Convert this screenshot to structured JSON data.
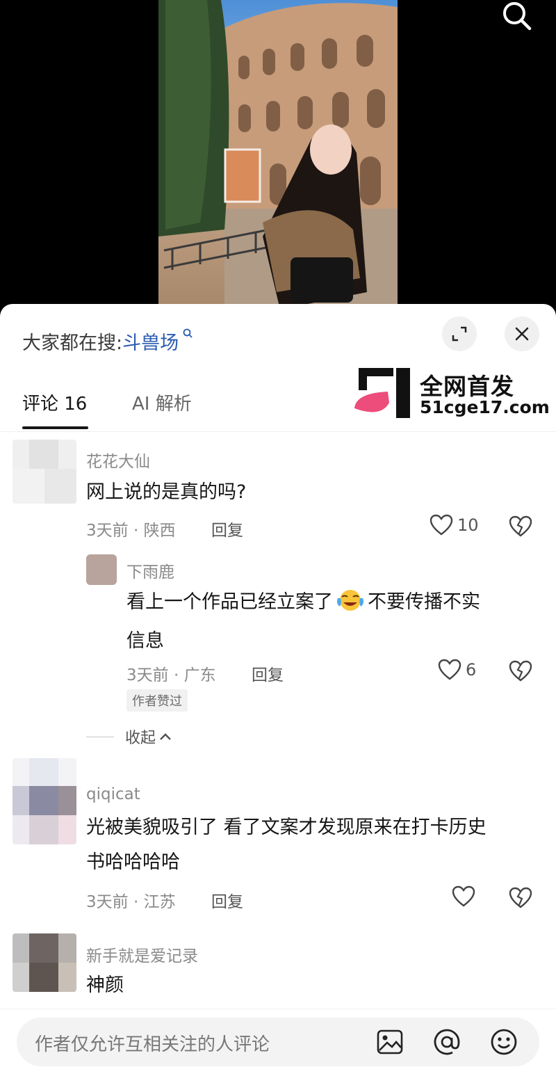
{
  "header": {
    "trending_prefix": "大家都在搜:",
    "trending_keyword": "斗兽场",
    "trending_suffix_icon": "search-small-icon"
  },
  "tabs": [
    {
      "label": "评论 16",
      "active": true
    },
    {
      "label": "AI 解析",
      "active": false
    }
  ],
  "watermark": {
    "line1": "全网首发",
    "line2": "51cge17.com"
  },
  "comments": [
    {
      "username": "花花大仙",
      "text": "网上说的是真的吗?",
      "meta": "3天前 · 陕西",
      "reply_label": "回复",
      "likes": "10"
    },
    {
      "username": "下雨鹿",
      "text_part1": "看上一个作品已经立案了",
      "text_part2": "不要传播不实",
      "text_line2": "信息",
      "meta": "3天前 · 广东",
      "reply_label": "回复",
      "likes": "6",
      "badge": "作者赞过"
    },
    {
      "username": "qiqicat",
      "text_line1": "光被美貌吸引了 看了文案才发现原来在打卡历史",
      "text_line2": "书哈哈哈哈",
      "meta": "3天前 · 江苏",
      "reply_label": "回复",
      "likes": ""
    },
    {
      "username": "新手就是爱记录",
      "text": "神颜"
    }
  ],
  "collapse_label": "收起",
  "input": {
    "placeholder": "作者仅允许互相关注的人评论"
  },
  "colors": {
    "accent_link": "#2a5bb0",
    "watermark_pink": "#ec4d7a"
  }
}
